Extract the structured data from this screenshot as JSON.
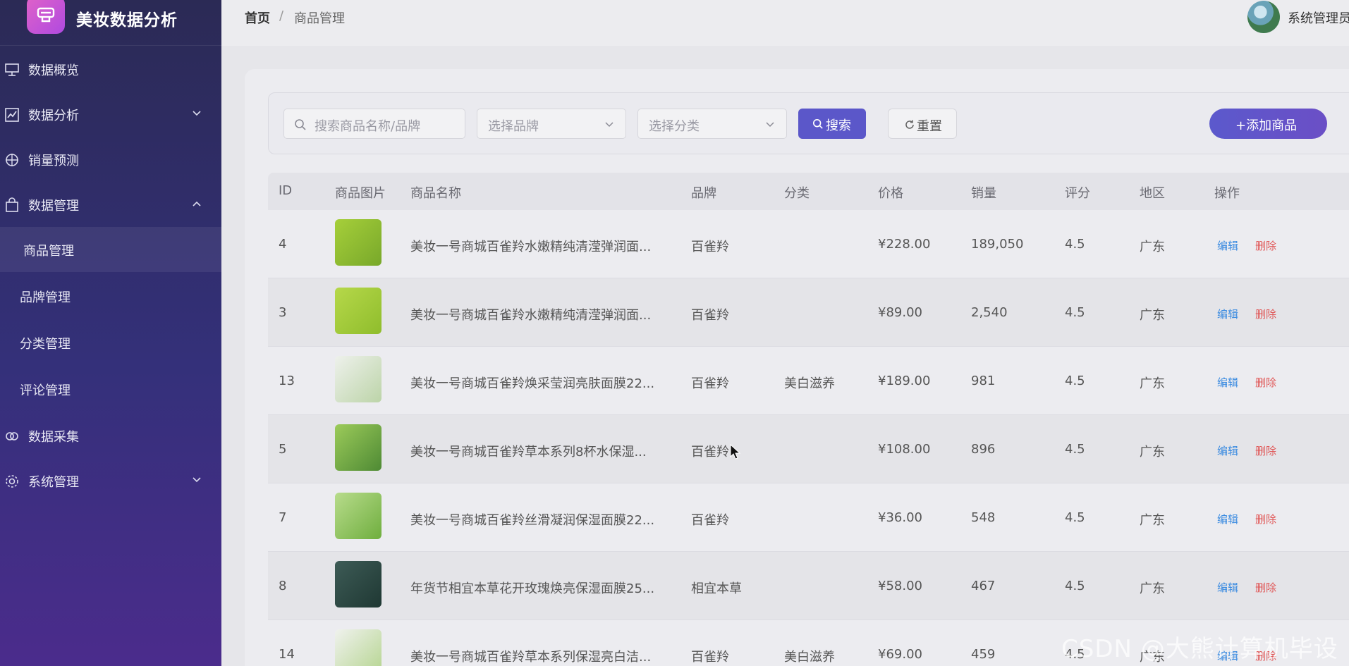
{
  "app": {
    "title": "美妆数据分析"
  },
  "sidebar": {
    "items": [
      {
        "label": "数据概览",
        "icon": "presentation-icon"
      },
      {
        "label": "数据分析",
        "icon": "line-chart-icon"
      },
      {
        "label": "销量预测",
        "icon": "crosshair-icon"
      },
      {
        "label": "数据管理",
        "icon": "bag-icon"
      },
      {
        "label": "商品管理"
      },
      {
        "label": "品牌管理"
      },
      {
        "label": "分类管理"
      },
      {
        "label": "评论管理"
      },
      {
        "label": "数据采集",
        "icon": "link-icon"
      },
      {
        "label": "系统管理",
        "icon": "gear-icon"
      }
    ]
  },
  "header": {
    "breadcrumb": [
      "首页",
      "/",
      "商品管理"
    ],
    "user_name": "系统管理员"
  },
  "filters": {
    "search_placeholder": "搜索商品名称/品牌",
    "brand_placeholder": "选择品牌",
    "category_placeholder": "选择分类",
    "search_label": "搜索",
    "reset_label": "重置",
    "add_label": "+添加商品"
  },
  "table": {
    "columns": [
      "ID",
      "商品图片",
      "商品名称",
      "品牌",
      "分类",
      "价格",
      "销量",
      "评分",
      "地区",
      "操作"
    ],
    "edit_label": "编辑",
    "delete_label": "删除",
    "rows": [
      {
        "id": "4",
        "name": "美妆一号商城百雀羚水嫩精纯清滢弹润面...",
        "brand": "百雀羚",
        "category": "",
        "price": "¥228.00",
        "sales": "189,050",
        "rating": "4.5",
        "region": "广东"
      },
      {
        "id": "3",
        "name": "美妆一号商城百雀羚水嫩精纯清滢弹润面...",
        "brand": "百雀羚",
        "category": "",
        "price": "¥89.00",
        "sales": "2,540",
        "rating": "4.5",
        "region": "广东"
      },
      {
        "id": "13",
        "name": "美妆一号商城百雀羚焕采莹润亮肤面膜22...",
        "brand": "百雀羚",
        "category": "美白滋养",
        "price": "¥189.00",
        "sales": "981",
        "rating": "4.5",
        "region": "广东"
      },
      {
        "id": "5",
        "name": "美妆一号商城百雀羚草本系列8杯水保湿...",
        "brand": "百雀羚",
        "category": "",
        "price": "¥108.00",
        "sales": "896",
        "rating": "4.5",
        "region": "广东"
      },
      {
        "id": "7",
        "name": "美妆一号商城百雀羚丝滑凝润保湿面膜22...",
        "brand": "百雀羚",
        "category": "",
        "price": "¥36.00",
        "sales": "548",
        "rating": "4.5",
        "region": "广东"
      },
      {
        "id": "8",
        "name": "年货节相宜本草花开玫瑰焕亮保湿面膜25...",
        "brand": "相宜本草",
        "category": "",
        "price": "¥58.00",
        "sales": "467",
        "rating": "4.5",
        "region": "广东"
      },
      {
        "id": "14",
        "name": "美妆一号商城百雀羚草本系列保湿亮白洁...",
        "brand": "百雀羚",
        "category": "美白滋养",
        "price": "¥69.00",
        "sales": "459",
        "rating": "4.5",
        "region": "广东"
      }
    ]
  },
  "watermark": "CSDN @大熊计算机毕设",
  "colors": {
    "primary": "#5b57c9",
    "edit": "#3b8be0",
    "delete": "#e05656",
    "sidebar_top": "#2b2a55",
    "sidebar_bottom": "#4b2c8c"
  }
}
